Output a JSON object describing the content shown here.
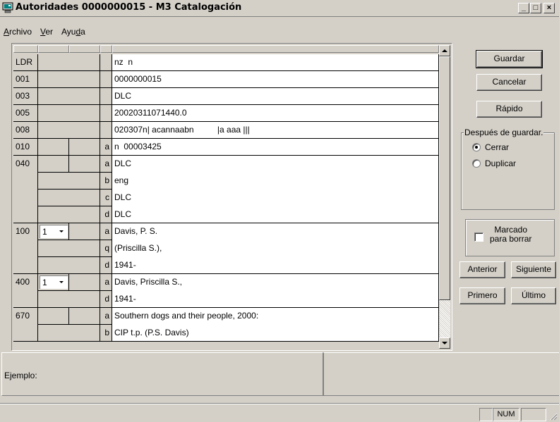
{
  "window": {
    "title": "Autoridades 0000000015 - M3 Catalogación",
    "app_icon": "computer-app-icon",
    "minimize_label": "_",
    "maximize_label": "□",
    "close_label": "×"
  },
  "menu": {
    "items": [
      {
        "label": "Archivo",
        "accel_index": 0
      },
      {
        "label": "Ver",
        "accel_index": 0
      },
      {
        "label": "Ayuda",
        "accel_index": 3
      }
    ]
  },
  "grid": {
    "rows": [
      {
        "tag": "LDR",
        "ind1": "",
        "ind2": "",
        "sub": "",
        "value": "nz  n"
      },
      {
        "tag": "001",
        "ind1": "",
        "ind2": "",
        "sub": "",
        "value": "0000000015"
      },
      {
        "tag": "003",
        "ind1": "",
        "ind2": "",
        "sub": "",
        "value": "DLC"
      },
      {
        "tag": "005",
        "ind1": "",
        "ind2": "",
        "sub": "",
        "value": "20020311071440.0"
      },
      {
        "tag": "008",
        "ind1": "",
        "ind2": "",
        "sub": "",
        "value": "020307n| acannaabn          |a aaa |||"
      },
      {
        "tag": "010",
        "ind1": "",
        "ind2": "",
        "sub": "a",
        "value": "n  00003425"
      },
      {
        "tag": "040",
        "ind1": "",
        "ind2": "",
        "sub": "a",
        "value": "DLC"
      },
      {
        "tag": "",
        "ind1": "",
        "ind2": "",
        "sub": "b",
        "value": "eng"
      },
      {
        "tag": "",
        "ind1": "",
        "ind2": "",
        "sub": "c",
        "value": "DLC"
      },
      {
        "tag": "",
        "ind1": "",
        "ind2": "",
        "sub": "d",
        "value": "DLC"
      },
      {
        "tag": "100",
        "ind1": "1",
        "ind2": "",
        "sub": "a",
        "value": "Davis, P. S."
      },
      {
        "tag": "",
        "ind1": "",
        "ind2": "",
        "sub": "q",
        "value": "(Priscilla S.),"
      },
      {
        "tag": "",
        "ind1": "",
        "ind2": "",
        "sub": "d",
        "value": "1941-"
      },
      {
        "tag": "400",
        "ind1": "1",
        "ind2": "",
        "sub": "a",
        "value": "Davis, Priscilla S.,"
      },
      {
        "tag": "",
        "ind1": "",
        "ind2": "",
        "sub": "d",
        "value": "1941-"
      },
      {
        "tag": "670",
        "ind1": "",
        "ind2": "",
        "sub": "a",
        "value": "Southern dogs and their people, 2000:"
      },
      {
        "tag": "",
        "ind1": "",
        "ind2": "",
        "sub": "b",
        "value": "CIP t.p. (P.S. Davis)"
      }
    ]
  },
  "actions": {
    "save": "Guardar",
    "cancel": "Cancelar",
    "quick": "Rápido",
    "previous": "Anterior",
    "next": "Siguiente",
    "first": "Primero",
    "last": "Último"
  },
  "after_save": {
    "legend": "Después de guardar.",
    "options": [
      "Cerrar",
      "Duplicar"
    ],
    "selected": "Cerrar"
  },
  "mark_delete": {
    "line1": "Marcado",
    "line2": "para borrar",
    "checked": false
  },
  "example": {
    "label": "Ejemplo:"
  },
  "status": {
    "num": "NUM"
  }
}
